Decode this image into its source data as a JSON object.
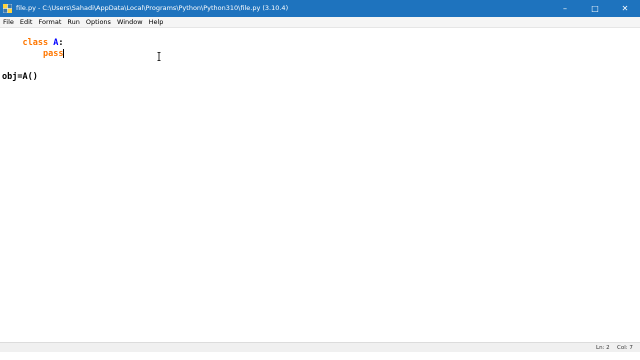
{
  "window": {
    "title": "file.py - C:\\Users\\Sahadi\\AppData\\Local\\Programs\\Python\\Python310\\file.py (3.10.4)",
    "titlebar_color": "#1e73be",
    "minimize": "–",
    "maximize": "□",
    "close": "✕"
  },
  "menu": {
    "items": [
      "File",
      "Edit",
      "Format",
      "Run",
      "Options",
      "Window",
      "Help"
    ]
  },
  "editor": {
    "lines": [
      {
        "keyword": "class",
        "space": " ",
        "name": "A",
        "rest": ":"
      },
      {
        "indent": "    ",
        "keyword": "pass"
      },
      {
        "text": ""
      },
      {
        "text": ""
      },
      {
        "text": "obj=A()"
      }
    ],
    "keyword_color": "#ff7700",
    "name_color": "#0000ff"
  },
  "status": {
    "line": "Ln: 2",
    "col": "Col: 7"
  }
}
